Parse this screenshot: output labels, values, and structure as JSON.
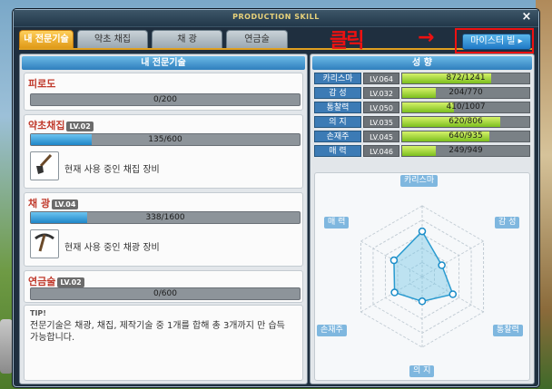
{
  "window": {
    "title": "PRODUCTION SKILL",
    "close_icon": "×"
  },
  "tabs": [
    {
      "label": "내 전문기술",
      "active": true
    },
    {
      "label": "약초 채집",
      "active": false
    },
    {
      "label": "채 광",
      "active": false
    },
    {
      "label": "연금술",
      "active": false
    }
  ],
  "master_button": {
    "label": "마이스터 빌 ▸"
  },
  "annotation": {
    "text": "클릭",
    "arrow": "→",
    "color": "#ee1111"
  },
  "left_panel": {
    "header": "내 전문기술",
    "fatigue": {
      "title": "피로도",
      "value_text": "0/200",
      "fill": 0
    },
    "skills": [
      {
        "title": "약초채집",
        "lv": "LV.02",
        "value_text": "135/600",
        "fill": 0.225,
        "tool_text": "현재 사용 중인 채집 장비",
        "icon": "shovel-icon"
      },
      {
        "title": "채 광",
        "lv": "LV.04",
        "value_text": "338/1600",
        "fill": 0.211,
        "tool_text": "현재 사용 중인 채광 장비",
        "icon": "pickaxe-icon"
      },
      {
        "title": "연금술",
        "lv": "LV.02",
        "value_text": "0/600",
        "fill": 0
      }
    ],
    "tip": {
      "title": "TIP!",
      "body": "전문기술은 채광, 채집, 제작기술 중 1개를 합해 총 3개까지 만 습득 가능합니다."
    }
  },
  "right_panel": {
    "header": "성 향",
    "stats": [
      {
        "name": "카리스마",
        "lv": "LV.064",
        "value_text": "872/1241",
        "fill": 0.703
      },
      {
        "name": "감 성",
        "lv": "LV.032",
        "value_text": "204/770",
        "fill": 0.265
      },
      {
        "name": "통찰력",
        "lv": "LV.050",
        "value_text": "410/1007",
        "fill": 0.407
      },
      {
        "name": "의 지",
        "lv": "LV.035",
        "value_text": "620/806",
        "fill": 0.769
      },
      {
        "name": "손재주",
        "lv": "LV.045",
        "value_text": "640/935",
        "fill": 0.684
      },
      {
        "name": "매 력",
        "lv": "LV.046",
        "value_text": "249/949",
        "fill": 0.262
      }
    ],
    "radar": {
      "labels": [
        "카리스마",
        "감 성",
        "통찰력",
        "의 지",
        "손재주",
        "매 력"
      ],
      "levels": [
        64,
        32,
        50,
        35,
        45,
        46
      ],
      "max": 100
    }
  }
}
